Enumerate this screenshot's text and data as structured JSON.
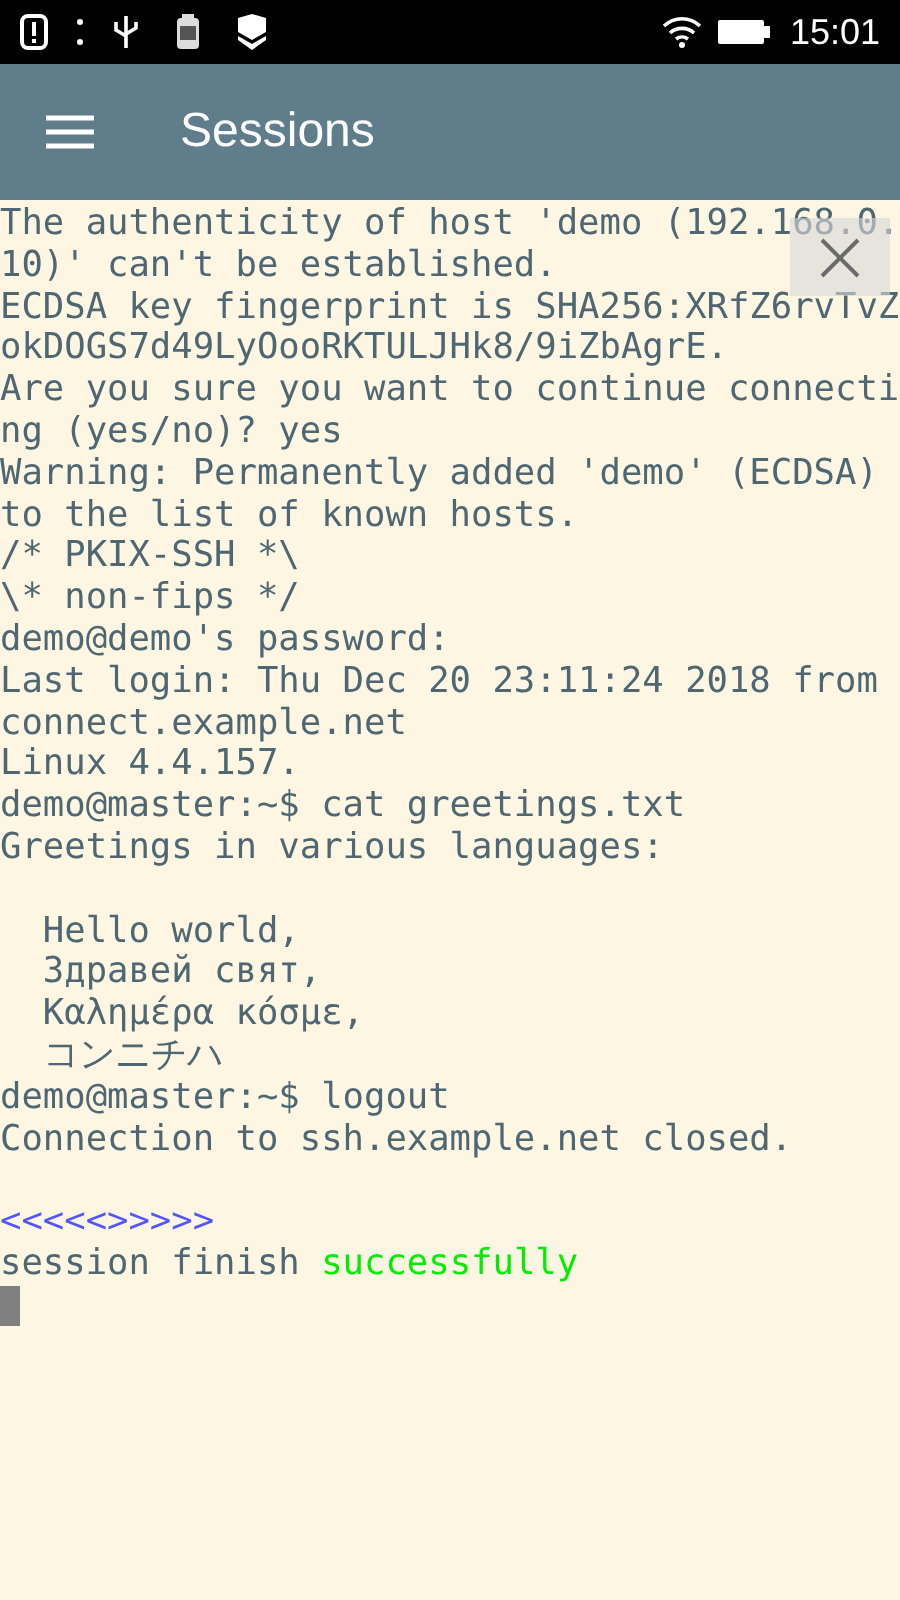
{
  "status_bar": {
    "time": "15:01"
  },
  "toolbar": {
    "title": "Sessions"
  },
  "terminal": {
    "lines": [
      {
        "kind": "text",
        "spans": [
          {
            "text": "The authenticity of host 'demo (192.168.0.",
            "kind": "output"
          }
        ]
      },
      {
        "kind": "text",
        "spans": [
          {
            "text": "10)' can't be established.",
            "kind": "output"
          }
        ]
      },
      {
        "kind": "text",
        "spans": [
          {
            "text": "ECDSA key fingerprint is SHA256:XRfZ6rvTvZ",
            "kind": "output"
          }
        ]
      },
      {
        "kind": "text",
        "spans": [
          {
            "text": "okDOGS7d49LyOooRKTULJHk8/9iZbAgrE.",
            "kind": "output"
          }
        ]
      },
      {
        "kind": "text",
        "spans": [
          {
            "text": "Are you sure you want to continue connecti",
            "kind": "output"
          }
        ]
      },
      {
        "kind": "text",
        "spans": [
          {
            "text": "ng (yes/no)? yes",
            "kind": "output"
          }
        ]
      },
      {
        "kind": "text",
        "spans": [
          {
            "text": "Warning: Permanently added 'demo' (ECDSA)",
            "kind": "output"
          }
        ]
      },
      {
        "kind": "text",
        "spans": [
          {
            "text": "to the list of known hosts.",
            "kind": "output"
          }
        ]
      },
      {
        "kind": "text",
        "spans": [
          {
            "text": "/* PKIX-SSH *\\",
            "kind": "output"
          }
        ]
      },
      {
        "kind": "text",
        "spans": [
          {
            "text": "\\* non-fips */",
            "kind": "output"
          }
        ]
      },
      {
        "kind": "text",
        "spans": [
          {
            "text": "demo@demo's password:",
            "kind": "output"
          }
        ]
      },
      {
        "kind": "text",
        "spans": [
          {
            "text": "Last login: Thu Dec 20 23:11:24 2018 from",
            "kind": "output"
          }
        ]
      },
      {
        "kind": "text",
        "spans": [
          {
            "text": "connect.example.net",
            "kind": "output"
          }
        ]
      },
      {
        "kind": "text",
        "spans": [
          {
            "text": "Linux 4.4.157.",
            "kind": "output"
          }
        ]
      },
      {
        "kind": "text",
        "spans": [
          {
            "text": "demo@master:~$ cat greetings.txt",
            "kind": "output"
          }
        ]
      },
      {
        "kind": "text",
        "spans": [
          {
            "text": "Greetings in various languages:",
            "kind": "output"
          }
        ]
      },
      {
        "kind": "blank"
      },
      {
        "kind": "text",
        "spans": [
          {
            "text": "  Hello world,",
            "kind": "output"
          }
        ]
      },
      {
        "kind": "text",
        "spans": [
          {
            "text": "  Здравей свят,",
            "kind": "output"
          }
        ]
      },
      {
        "kind": "text",
        "spans": [
          {
            "text": "  Καλημέρα κόσμε,",
            "kind": "output"
          }
        ]
      },
      {
        "kind": "text",
        "spans": [
          {
            "text": "  コンニチハ",
            "kind": "output"
          }
        ]
      },
      {
        "kind": "text",
        "spans": [
          {
            "text": "demo@master:~$ logout",
            "kind": "output"
          }
        ]
      },
      {
        "kind": "text",
        "spans": [
          {
            "text": "Connection to ssh.example.net closed.",
            "kind": "output"
          }
        ]
      },
      {
        "kind": "blank"
      },
      {
        "kind": "text",
        "spans": [
          {
            "text": "<<<<<>>>>>",
            "kind": "marker"
          }
        ]
      },
      {
        "kind": "text",
        "spans": [
          {
            "text": "session finish ",
            "kind": "output"
          },
          {
            "text": "successfully",
            "kind": "success"
          }
        ]
      },
      {
        "kind": "cursor"
      }
    ]
  }
}
